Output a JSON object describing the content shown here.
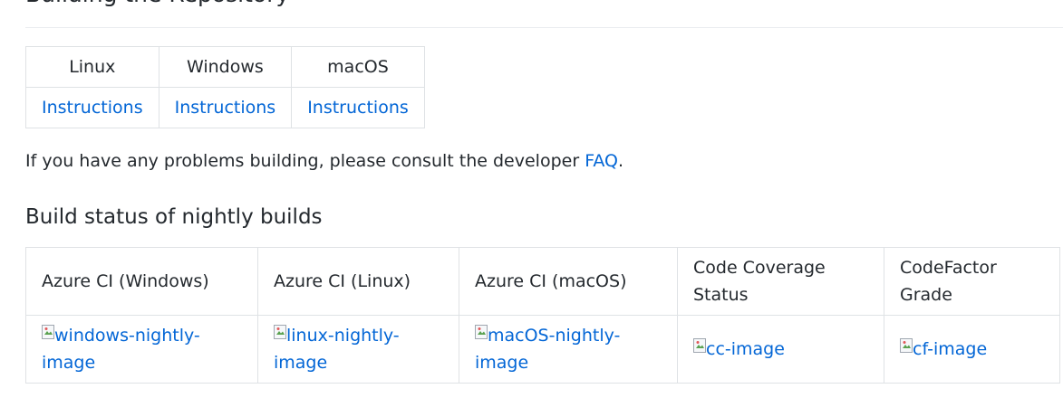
{
  "headings": {
    "building": "Building the Repository",
    "nightly": "Build status of nightly builds"
  },
  "os_table": {
    "headers": [
      "Linux",
      "Windows",
      "macOS"
    ],
    "links": [
      "Instructions",
      "Instructions",
      "Instructions"
    ]
  },
  "faq_paragraph": {
    "before": "If you have any problems building, please consult the developer ",
    "link": "FAQ",
    "after": "."
  },
  "builds_table": {
    "headers": [
      "Azure CI (Windows)",
      "Azure CI (Linux)",
      "Azure CI (macOS)",
      "Code Coverage Status",
      "CodeFactor Grade"
    ],
    "images": [
      "windows-nightly-image",
      "linux-nightly-image",
      "macOS-nightly-image",
      "cc-image",
      "cf-image"
    ]
  },
  "colors": {
    "link": "#0366d6",
    "text": "#24292e",
    "border": "#dfe2e5"
  },
  "icons": {
    "broken_image": "broken-image-icon"
  }
}
